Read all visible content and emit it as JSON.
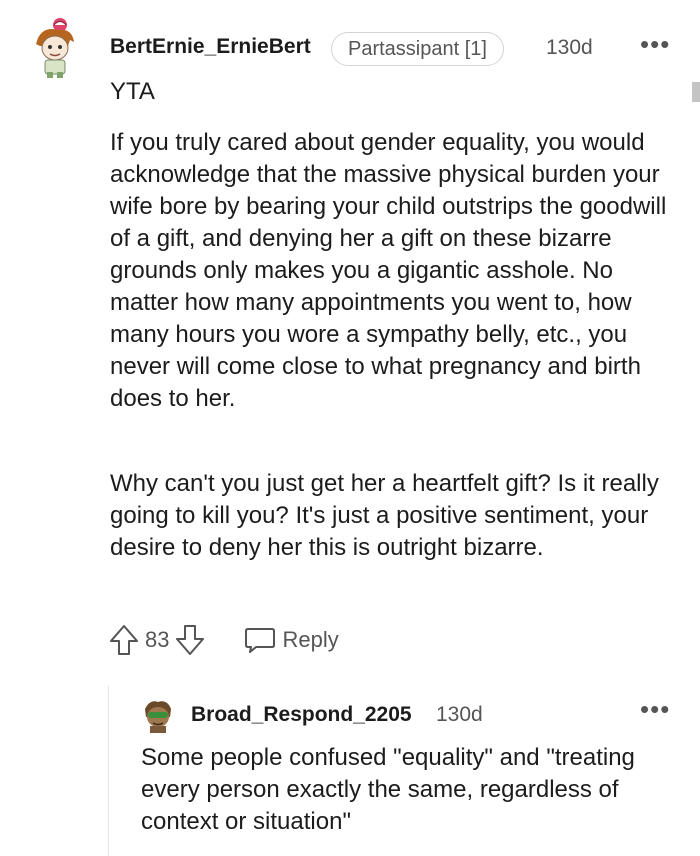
{
  "comment": {
    "username": "BertErnie_ErnieBert",
    "flair": "Partassipant [1]",
    "age": "130d",
    "more_icon": "more-horizontal-icon",
    "paragraphs": [
      "YTA",
      "If you truly cared about gender equality, you would acknowledge that the massive physical burden your wife bore by bearing your child outstrips the goodwill of a gift, and denying her a gift on these bizarre grounds only makes you a gigantic asshole. No matter how many appointments you went to, how many hours you wore a sympathy belly, etc., you never will come close to what pregnancy and birth does to her.",
      "Why can't you just get her a heartfelt gift? Is it really going to kill you? It's just a positive sentiment, your desire to deny her this is outright bizarre."
    ],
    "votes": "83",
    "reply_label": "Reply"
  },
  "reply": {
    "username": "Broad_Respond_2205",
    "age": "130d",
    "more_icon": "more-horizontal-icon",
    "text": "Some people confused \"equality\" and \"treating every person exactly the same, regardless of context or situation\""
  },
  "colors": {
    "text": "#1c1c1c",
    "muted": "#555555",
    "border": "#d4d4d4",
    "avatar_hair": "#b5651d",
    "avatar_cap": "#e0436b",
    "reply_avatar": "#3a8f3a"
  }
}
